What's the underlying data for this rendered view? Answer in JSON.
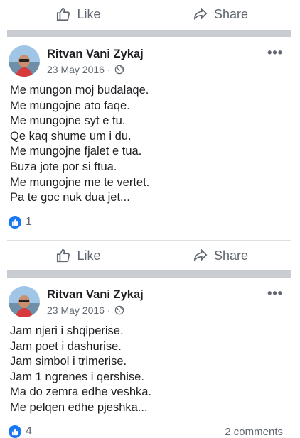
{
  "actions": {
    "like_label": "Like",
    "share_label": "Share"
  },
  "icons": {
    "like": "thumbs-up-icon",
    "share": "share-arrow-icon",
    "privacy": "globe-icon",
    "more": "ellipsis-icon",
    "reaction": "like-reaction-icon"
  },
  "colors": {
    "reaction_blue": "#1877f2",
    "divider_grey": "#c9ccd1",
    "secondary_text": "#606770"
  },
  "posts": [
    {
      "author": "Ritvan Vani Zykaj",
      "date": "23 May 2016 ·",
      "more": "•••",
      "lines": [
        "Me mungon moj budalaqe.",
        "Me mungojne ato faqe.",
        "Me mungojne syt e tu.",
        "Qe kaq shume um i du.",
        "Me mungojne fjalet e tua.",
        "Buza jote por si ftua.",
        "Me mungojne me te vertet.",
        "Pa te goc nuk dua jet..."
      ],
      "reaction_count": "1"
    },
    {
      "author": "Ritvan Vani Zykaj",
      "date": "23 May 2016 ·",
      "more": "•••",
      "lines": [
        "Jam njeri i shqiperise.",
        "Jam poet i dashurise.",
        "Jam simbol i trimerise.",
        "Jam 1 ngrenes i qershise.",
        "Ma do zemra edhe veshka.",
        "Me pelqen edhe pjeshka..."
      ],
      "reaction_count": "4",
      "comments": "2 comments"
    }
  ]
}
